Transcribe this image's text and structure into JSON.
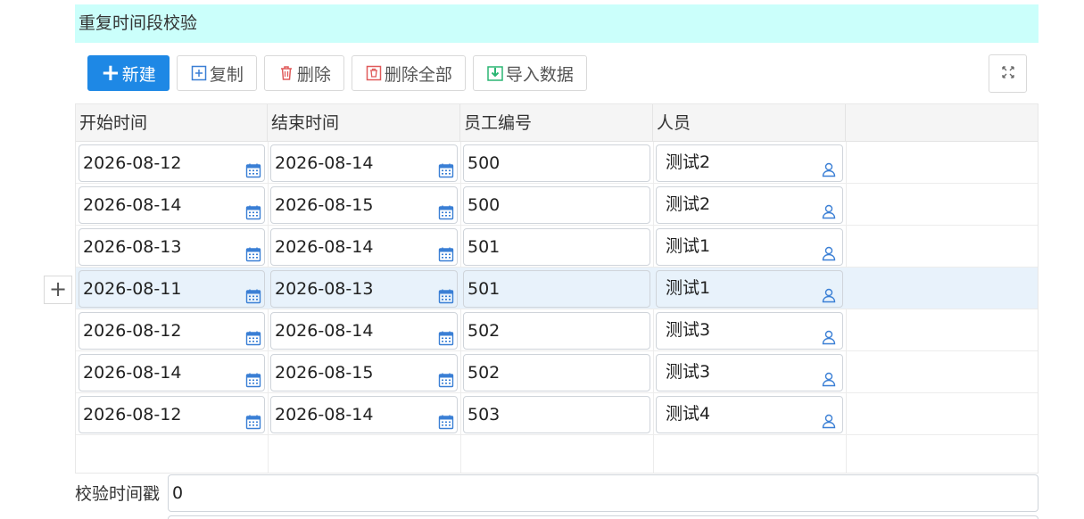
{
  "section": {
    "title": "重复时间段校验"
  },
  "toolbar": {
    "new_label": "新建",
    "copy_label": "复制",
    "delete_label": "删除",
    "delete_all_label": "删除全部",
    "import_label": "导入数据"
  },
  "grid": {
    "columns": [
      "开始时间",
      "结束时间",
      "员工编号",
      "人员"
    ],
    "rows": [
      {
        "start": "2026-08-12",
        "end": "2026-08-14",
        "emp_no": "500",
        "person": "测试2"
      },
      {
        "start": "2026-08-14",
        "end": "2026-08-15",
        "emp_no": "500",
        "person": "测试2"
      },
      {
        "start": "2026-08-13",
        "end": "2026-08-14",
        "emp_no": "501",
        "person": "测试1"
      },
      {
        "start": "2026-08-11",
        "end": "2026-08-13",
        "emp_no": "501",
        "person": "测试1"
      },
      {
        "start": "2026-08-12",
        "end": "2026-08-14",
        "emp_no": "502",
        "person": "测试3"
      },
      {
        "start": "2026-08-14",
        "end": "2026-08-15",
        "emp_no": "502",
        "person": "测试3"
      },
      {
        "start": "2026-08-12",
        "end": "2026-08-14",
        "emp_no": "503",
        "person": "测试4"
      }
    ],
    "add_row_symbol": "+"
  },
  "footer": {
    "timestamp_label": "校验时间戳",
    "timestamp_value": "0"
  },
  "colors": {
    "primary": "#1e88e5",
    "header_bg": "#cbfffb",
    "selected_row": "#e8f2fb",
    "calendar_icon": "#3a7fd5",
    "delete_icon": "#e05a5a",
    "import_icon": "#2bb673"
  }
}
